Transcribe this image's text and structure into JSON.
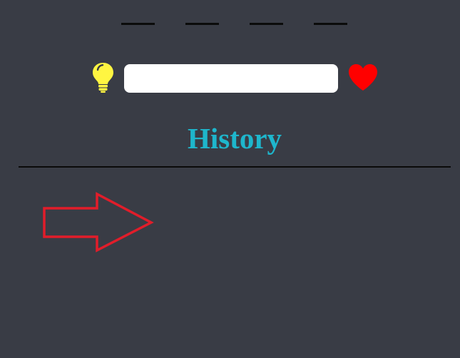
{
  "game": {
    "slot_count": 4,
    "slots": [
      "",
      "",
      "",
      ""
    ]
  },
  "controls": {
    "hint_icon": "lightbulb-icon",
    "guess_input_value": "",
    "guess_input_placeholder": "",
    "heart_icon": "heart-icon"
  },
  "history": {
    "title": "History",
    "entries": []
  },
  "annotation": {
    "icon": "arrow-right-outline-icon"
  },
  "colors": {
    "background": "#393c45",
    "title": "#1eb6cc",
    "hint": "#fff541",
    "heart": "#ff0000",
    "arrow": "#e11d2a",
    "input_bg": "#ffffff"
  }
}
